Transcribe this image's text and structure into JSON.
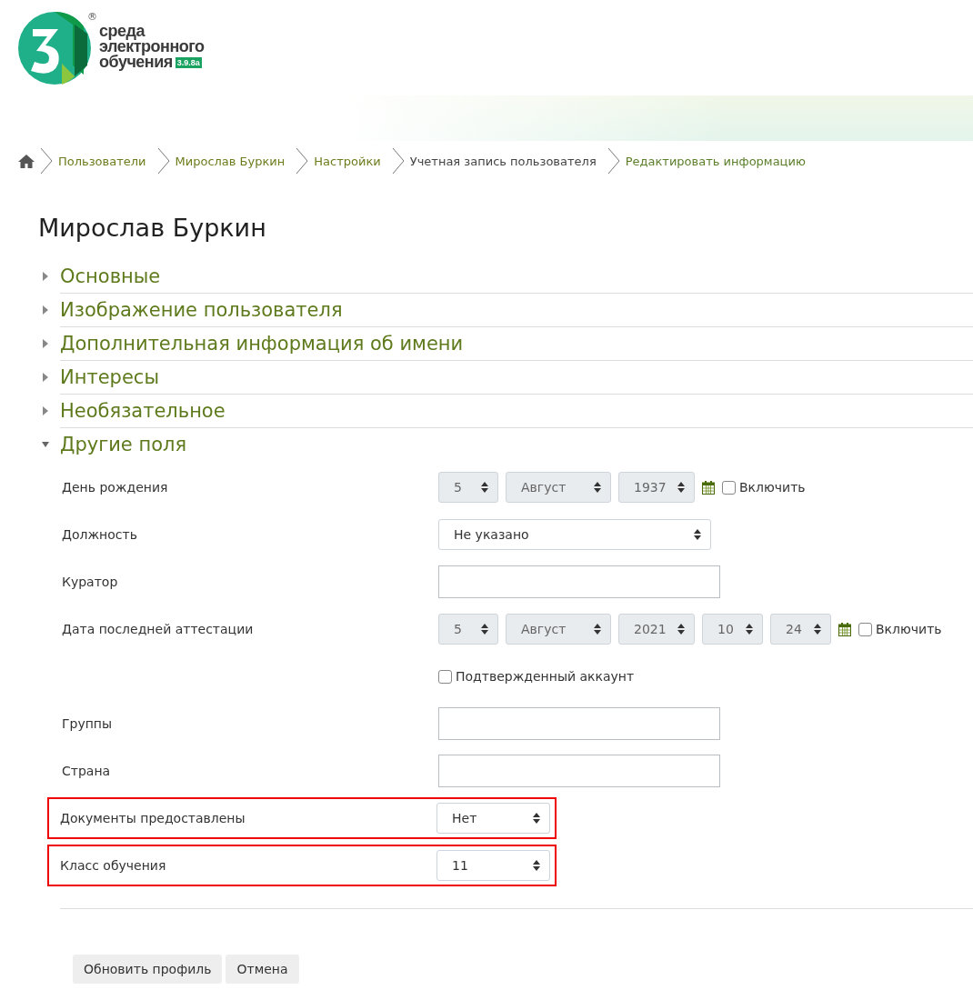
{
  "logo": {
    "mark": "®",
    "lines": [
      "среда",
      "электронного",
      "обучения"
    ],
    "version": "3.9.8a"
  },
  "breadcrumb": [
    "Пользователи",
    "Мирослав Буркин",
    "Настройки",
    "Учетная запись пользователя",
    "Редактировать информацию"
  ],
  "title": "Мирослав Буркин",
  "sections": [
    {
      "title": "Основные",
      "expanded": false
    },
    {
      "title": "Изображение пользователя",
      "expanded": false
    },
    {
      "title": "Дополнительная информация об имени",
      "expanded": false
    },
    {
      "title": "Интересы",
      "expanded": false
    },
    {
      "title": "Необязательное",
      "expanded": false
    },
    {
      "title": "Другие поля",
      "expanded": true
    }
  ],
  "fields": [
    {
      "kind": "date",
      "label": "День рождения",
      "parts": [
        "5",
        "Август",
        "1937"
      ],
      "disabled": true,
      "enable": {
        "label": "Включить",
        "checked": false
      },
      "highlighted": false
    },
    {
      "kind": "menu",
      "label": "Должность",
      "value": "Не указано",
      "highlighted": false
    },
    {
      "kind": "text",
      "label": "Куратор",
      "highlighted": false
    },
    {
      "kind": "date",
      "label": "Дата последней аттестации",
      "parts": [
        "5",
        "Август",
        "2021",
        "10",
        "24"
      ],
      "disabled": true,
      "enable": {
        "label": "Включить",
        "checked": false
      },
      "highlighted": false
    },
    {
      "kind": "checkbox",
      "label": "Подтвержденный аккаунт",
      "checked": false,
      "highlighted": false
    },
    {
      "kind": "text",
      "label": "Группы",
      "highlighted": false
    },
    {
      "kind": "text",
      "label": "Страна",
      "highlighted": false
    },
    {
      "kind": "select",
      "label": "Документы предоставлены",
      "value": "Нет",
      "highlighted": true
    },
    {
      "kind": "select",
      "label": "Класс обучения",
      "value": "11",
      "highlighted": true
    }
  ],
  "buttons": [
    "Обновить профиль",
    "Отмена"
  ]
}
